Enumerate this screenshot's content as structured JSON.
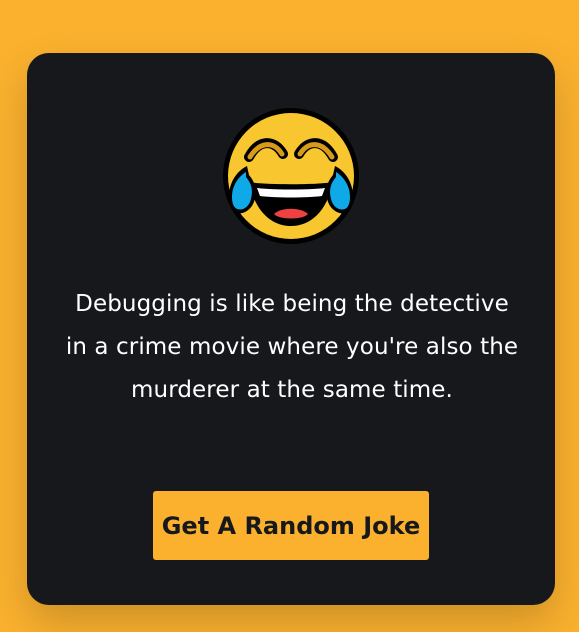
{
  "emoji": {
    "icon": "face-with-tears-of-joy-icon"
  },
  "joke": {
    "text": "Debugging is like being the detective in a crime movie where you're also the murderer at the same time."
  },
  "button": {
    "label": "Get A Random Joke"
  },
  "colors": {
    "page_background": "#fbb12e",
    "card_background": "#16181b",
    "button_background": "#fbb12e",
    "button_text": "#16181b",
    "joke_text": "#ffffff"
  }
}
